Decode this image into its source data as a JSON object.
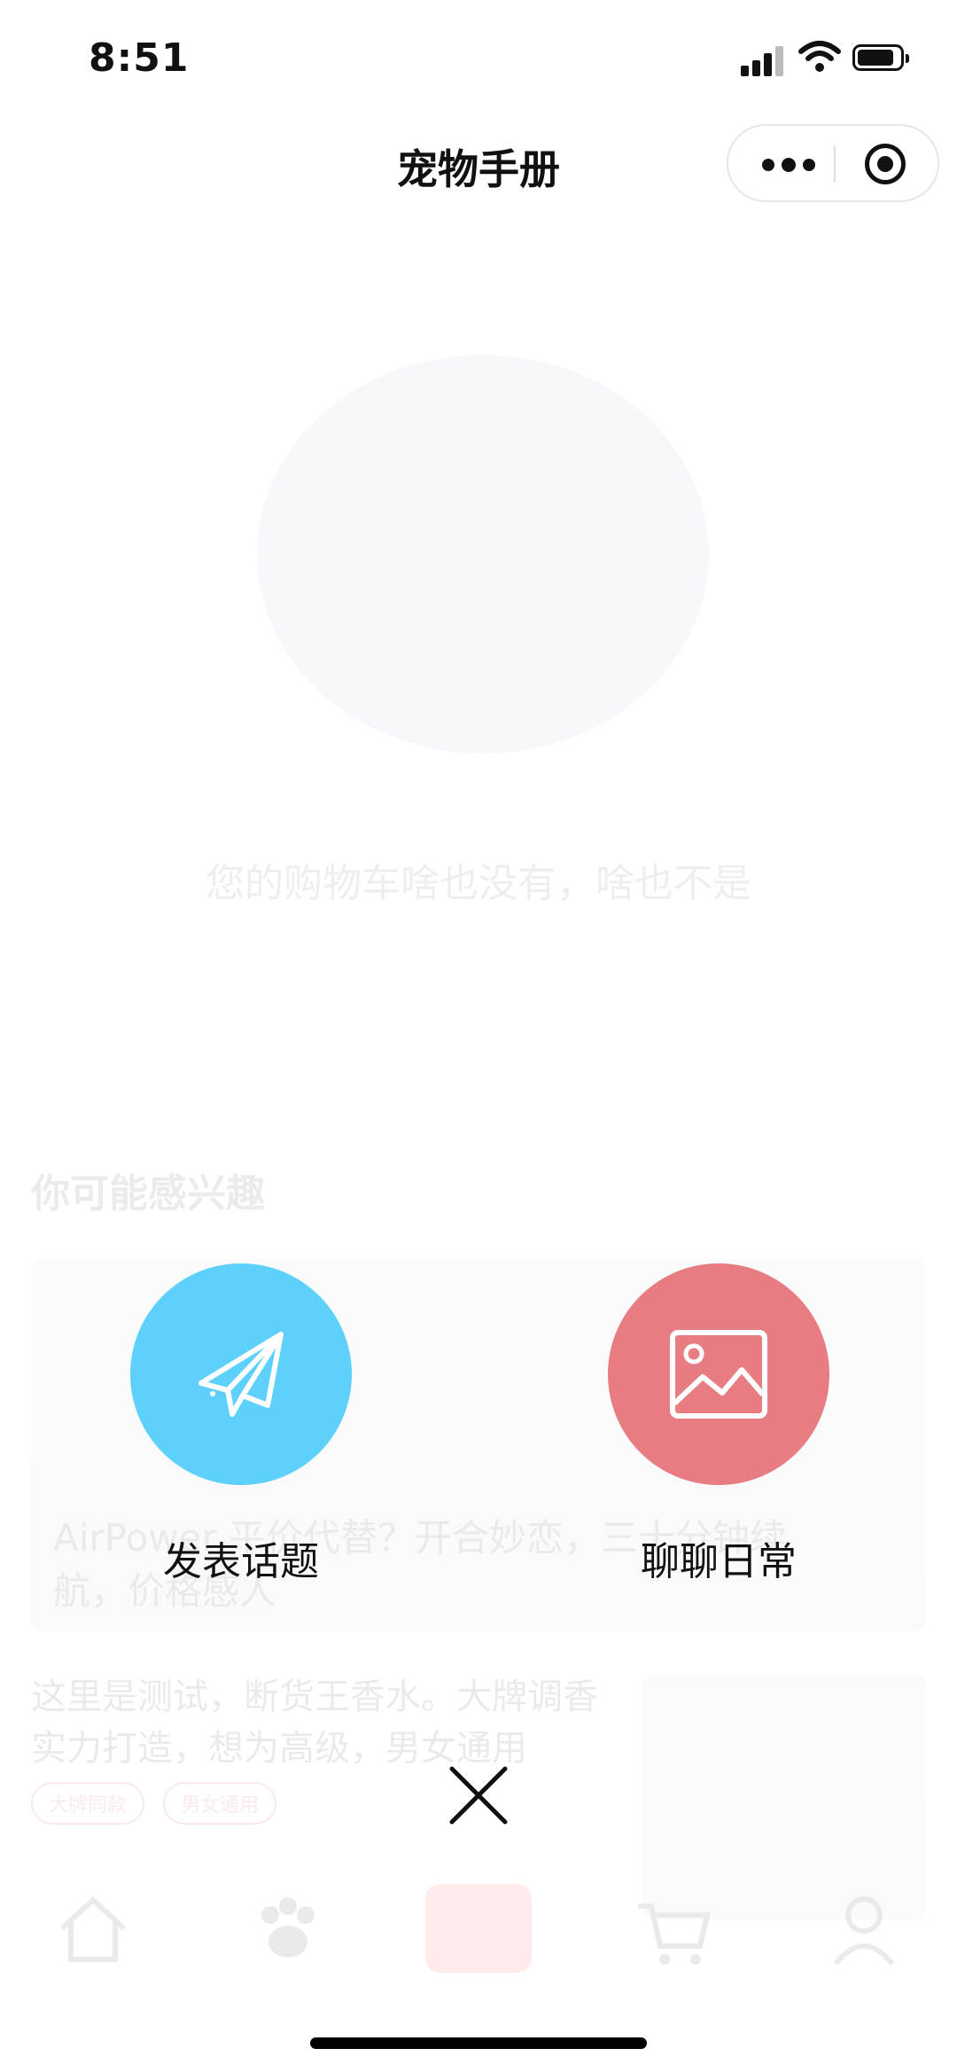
{
  "status_bar": {
    "time": "8:51"
  },
  "nav": {
    "title": "宠物手册"
  },
  "background": {
    "empty_text": "您的购物车啥也没有，啥也不是",
    "section_title": "你可能感兴趣",
    "card_title": "AirPower 平价代替？开合妙恋，三十分钟续航，价格感人",
    "item_title": "这里是测试，断货王香水。大牌调香实力打造，想为高级，男女通用",
    "item_tags": [
      "大牌同款",
      "男女通用"
    ],
    "tabs": [
      "home-icon",
      "paw-icon",
      "medical-cross-icon",
      "cart-icon",
      "user-icon"
    ]
  },
  "actions": [
    {
      "label": "发表话题",
      "color": "#5dd0fb",
      "icon": "paper-plane-icon"
    },
    {
      "label": "聊聊日常",
      "color": "#e77c82",
      "icon": "image-icon"
    }
  ],
  "close": {
    "icon": "close-icon"
  }
}
